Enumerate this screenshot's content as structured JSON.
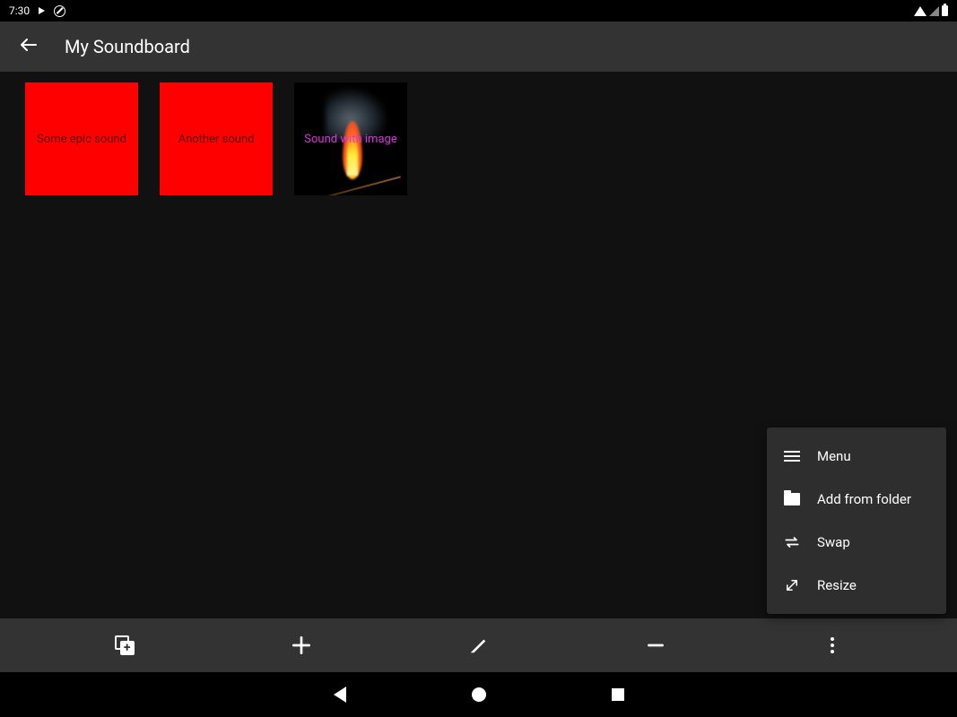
{
  "statusbar": {
    "time": "7:30"
  },
  "appbar": {
    "title": "My Soundboard"
  },
  "sounds": [
    {
      "label": "Some epic sound",
      "type": "red"
    },
    {
      "label": "Another sound",
      "type": "red"
    },
    {
      "label": "Sound with image",
      "type": "image"
    }
  ],
  "popup": {
    "items": [
      {
        "icon": "menu",
        "label": "Menu"
      },
      {
        "icon": "folder",
        "label": "Add from folder"
      },
      {
        "icon": "swap",
        "label": "Swap"
      },
      {
        "icon": "resize",
        "label": "Resize"
      }
    ]
  }
}
